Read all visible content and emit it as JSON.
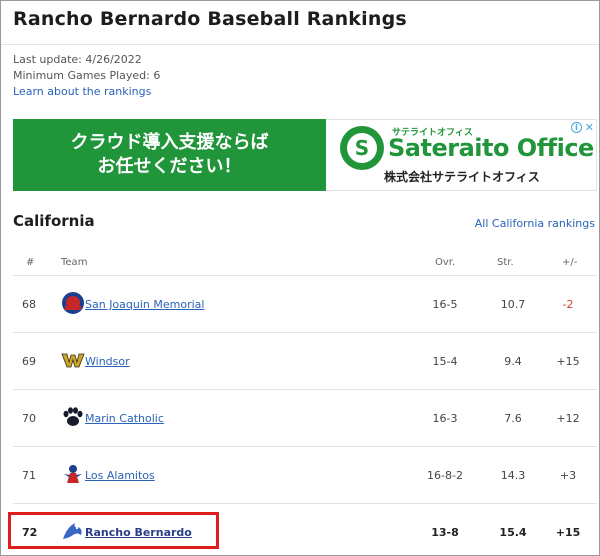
{
  "page": {
    "title": "Rancho Bernardo Baseball Rankings",
    "last_update": "Last update: 4/26/2022",
    "min_games": "Minimum Games Played: 6",
    "learn_link": "Learn about the rankings"
  },
  "ad": {
    "line1": "クラウド導入支援ならば",
    "line2": "お任せください！",
    "brand_small": "サテライトオフィス",
    "brand": "Sateraito Office",
    "company": "株式会社サテライトオフィス",
    "info": "i",
    "close": "✕"
  },
  "section": {
    "title": "California",
    "all_link": "All California rankings"
  },
  "table": {
    "headers": {
      "rank": "#",
      "team": "Team",
      "ovr": "Ovr.",
      "str": "Str.",
      "pm": "+/-"
    },
    "rows": [
      {
        "rank": "68",
        "team": "San Joaquin Memorial",
        "ovr": "16-5",
        "str": "10.7",
        "pm": "-2",
        "logo": "san-joaquin-memorial-logo"
      },
      {
        "rank": "69",
        "team": "Windsor",
        "ovr": "15-4",
        "str": "9.4",
        "pm": "+15",
        "logo": "windsor-logo"
      },
      {
        "rank": "70",
        "team": "Marin Catholic",
        "ovr": "16-3",
        "str": "7.6",
        "pm": "+12",
        "logo": "marin-catholic-logo"
      },
      {
        "rank": "71",
        "team": "Los Alamitos",
        "ovr": "16-8-2",
        "str": "14.3",
        "pm": "+3",
        "logo": "los-alamitos-logo"
      },
      {
        "rank": "72",
        "team": "Rancho Bernardo",
        "ovr": "13-8",
        "str": "15.4",
        "pm": "+15",
        "logo": "rancho-bernardo-logo"
      }
    ]
  },
  "colors": {
    "link": "#2a63b8",
    "negative": "#d23a2a",
    "ad_green": "#21953a",
    "highlight": "#e01e1e"
  }
}
